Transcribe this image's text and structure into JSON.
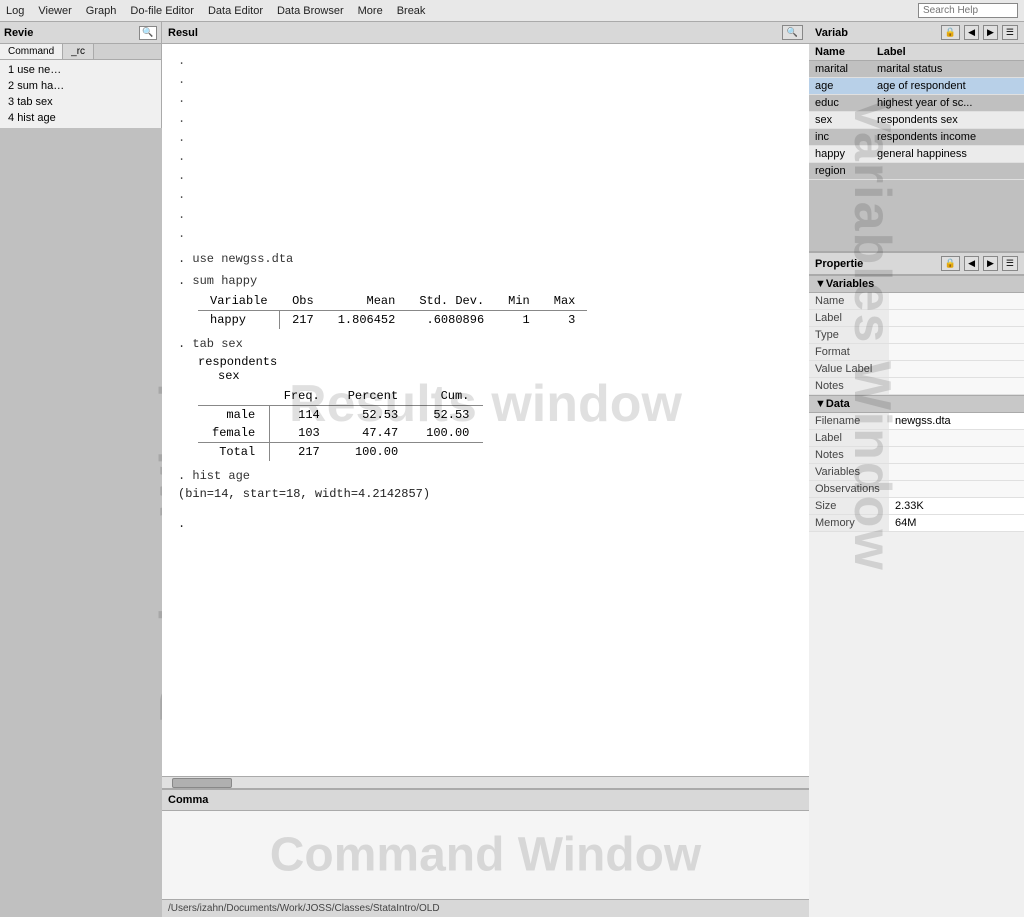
{
  "menu": {
    "items": [
      "Log",
      "Viewer",
      "Graph",
      "Do-file Editor",
      "Data Editor",
      "Data Browser",
      "More",
      "Break"
    ]
  },
  "search": {
    "placeholder": "Search Help"
  },
  "review": {
    "title": "Revie",
    "search_icon": "🔍",
    "tabs": [
      {
        "label": "Command",
        "active": true
      },
      {
        "label": "_rc",
        "active": false
      }
    ],
    "items": [
      {
        "number": "1",
        "text": "use ne…"
      },
      {
        "number": "2",
        "text": "sum ha…"
      },
      {
        "number": "3",
        "text": "tab sex"
      },
      {
        "number": "4",
        "text": "hist age"
      }
    ],
    "watermark": "Review Window"
  },
  "results": {
    "title": "Resul",
    "watermark": "Results window",
    "search_icon": "🔍",
    "dots": [
      ".",
      ".",
      ".",
      ".",
      ".",
      ".",
      ".",
      ".",
      ".",
      "."
    ],
    "cmd1": ". use newgss.dta",
    "cmd2": ". sum happy",
    "stat_table": {
      "headers": [
        "Variable",
        "Obs",
        "Mean",
        "Std. Dev.",
        "Min",
        "Max"
      ],
      "rows": [
        [
          "happy",
          "217",
          "1.806452",
          ".6080896",
          "1",
          "3"
        ]
      ]
    },
    "cmd3": ". tab sex",
    "freq_intro": "respondents",
    "freq_label": "sex",
    "freq_table": {
      "headers": [
        "",
        "Freq.",
        "Percent",
        "Cum."
      ],
      "rows": [
        [
          "male",
          "114",
          "52.53",
          "52.53"
        ],
        [
          "female",
          "103",
          "47.47",
          "100.00"
        ]
      ],
      "total_row": [
        "Total",
        "217",
        "100.00",
        ""
      ]
    },
    "cmd4": ". hist age",
    "hist_note": "(bin=14, start=18, width=4.2142857)",
    "final_dot": "."
  },
  "command": {
    "title": "Comma",
    "watermark": "Command Window"
  },
  "status_bar": {
    "path": "/Users/izahn/Documents/Work/JOSS/Classes/StataIntro/OLD"
  },
  "variables": {
    "title": "Variab",
    "watermark": "Variables Window",
    "columns": [
      "Name",
      "Label"
    ],
    "rows": [
      {
        "name": "marital",
        "label": "marital status",
        "selected": false
      },
      {
        "name": "age",
        "label": "age of respondent",
        "selected": true
      },
      {
        "name": "educ",
        "label": "highest year of sc...",
        "selected": false
      },
      {
        "name": "sex",
        "label": "respondents sex",
        "selected": false
      },
      {
        "name": "inc",
        "label": "respondents income",
        "selected": false
      },
      {
        "name": "happy",
        "label": "general happiness",
        "selected": false
      },
      {
        "name": "region",
        "label": "",
        "selected": false
      }
    ]
  },
  "properties": {
    "title": "Propertie",
    "variables_section": "▼Variables",
    "data_section": "▼Data",
    "var_fields": [
      {
        "key": "Name",
        "val": ""
      },
      {
        "key": "Label",
        "val": ""
      },
      {
        "key": "Type",
        "val": ""
      },
      {
        "key": "Format",
        "val": ""
      },
      {
        "key": "Value Label",
        "val": ""
      },
      {
        "key": "Notes",
        "val": ""
      }
    ],
    "data_fields": [
      {
        "key": "Filename",
        "val": "newgss.dta"
      },
      {
        "key": "Label",
        "val": ""
      },
      {
        "key": "Notes",
        "val": ""
      },
      {
        "key": "Variables",
        "val": ""
      },
      {
        "key": "Observations",
        "val": ""
      },
      {
        "key": "Size",
        "val": "2.33K"
      },
      {
        "key": "Memory",
        "val": "64M"
      }
    ]
  }
}
